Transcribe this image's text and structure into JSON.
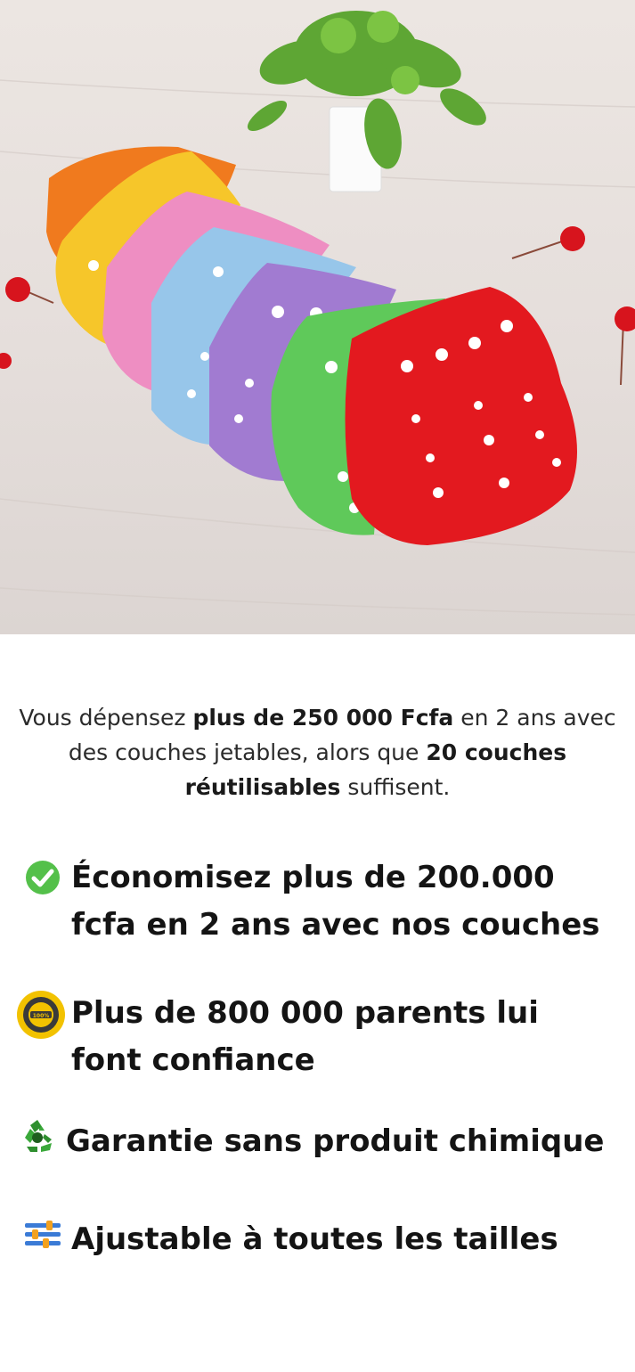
{
  "hero_image": {
    "icon": "reusable-cloth-diapers-photo",
    "diaper_colors": [
      "#f07a1e",
      "#f6c62a",
      "#ee8ec2",
      "#97c6ea",
      "#a17bd1",
      "#5fc95a",
      "#e3191f"
    ]
  },
  "intro": {
    "part1": "Vous dépensez ",
    "bold1": "plus de 250 000 Fcfa",
    "part2": " en 2 ans avec des couches jetables, alors que ",
    "bold2": "20 couches réutilisables",
    "part3": " suffisent."
  },
  "features": [
    {
      "icon": "check-circle-icon",
      "text": "Économisez plus de 200.000 fcfa en 2 ans avec nos couches"
    },
    {
      "icon": "quality-badge-icon",
      "text": "Plus de 800 000 parents lui font confiance"
    },
    {
      "icon": "recycle-icon",
      "text": "Garantie sans produit chimique"
    },
    {
      "icon": "adjust-sliders-icon",
      "text": "Ajustable à toutes les tailles"
    }
  ],
  "colors": {
    "check_green": "#54c04a",
    "badge_gold": "#f2c200",
    "recycle_green": "#3aa83a"
  }
}
